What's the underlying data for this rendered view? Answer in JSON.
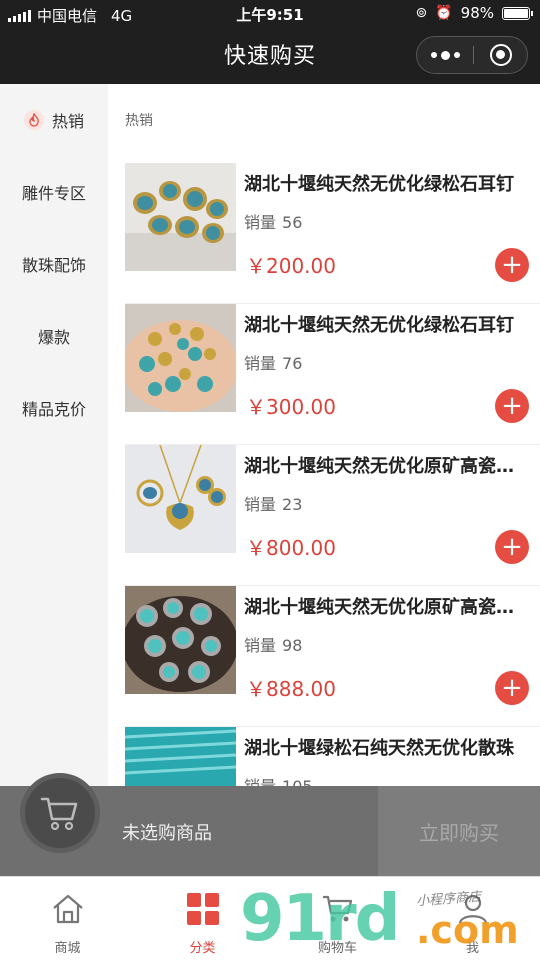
{
  "status_bar": {
    "carrier": "中国电信",
    "network": "4G",
    "time": "上午9:51",
    "battery": "98%"
  },
  "nav": {
    "title": "快速购买",
    "more_icon": "more-dots-icon",
    "close_icon": "target-close-icon"
  },
  "sidebar": {
    "items": [
      {
        "label": "热销",
        "active": true,
        "icon": "fire-icon"
      },
      {
        "label": "雕件专区"
      },
      {
        "label": "散珠配饰"
      },
      {
        "label": "爆款"
      },
      {
        "label": "精品克价"
      }
    ]
  },
  "main": {
    "section_title": "热销",
    "sales_label": "销量",
    "products": [
      {
        "name": "湖北十堰纯天然无优化绿松石耳钉",
        "sales": "56",
        "price": "￥200.00"
      },
      {
        "name": "湖北十堰纯天然无优化绿松石耳钉",
        "sales": "76",
        "price": "￥300.00"
      },
      {
        "name": "湖北十堰纯天然无优化原矿高瓷套装",
        "sales": "23",
        "price": "￥800.00"
      },
      {
        "name": "湖北十堰纯天然无优化原矿高瓷戒指",
        "sales": "98",
        "price": "￥888.00"
      },
      {
        "name": "湖北十堰绿松石纯天然无优化散珠",
        "sales": "105",
        "price": ""
      }
    ]
  },
  "cart_bar": {
    "empty_text": "未选购商品",
    "buy_label": "立即购买"
  },
  "tabbar": {
    "tabs": [
      {
        "label": "商城",
        "icon": "home-icon"
      },
      {
        "label": "分类",
        "icon": "grid-icon",
        "active": true
      },
      {
        "label": "购物车",
        "icon": "cart-icon"
      },
      {
        "label": "我",
        "icon": "user-icon"
      }
    ]
  },
  "watermark": {
    "brand": "91rd",
    "suffix": ".com",
    "shop": "小程序商店"
  },
  "colors": {
    "accent": "#e54d42",
    "price": "#d9433b",
    "header": "#1f1f1f"
  }
}
